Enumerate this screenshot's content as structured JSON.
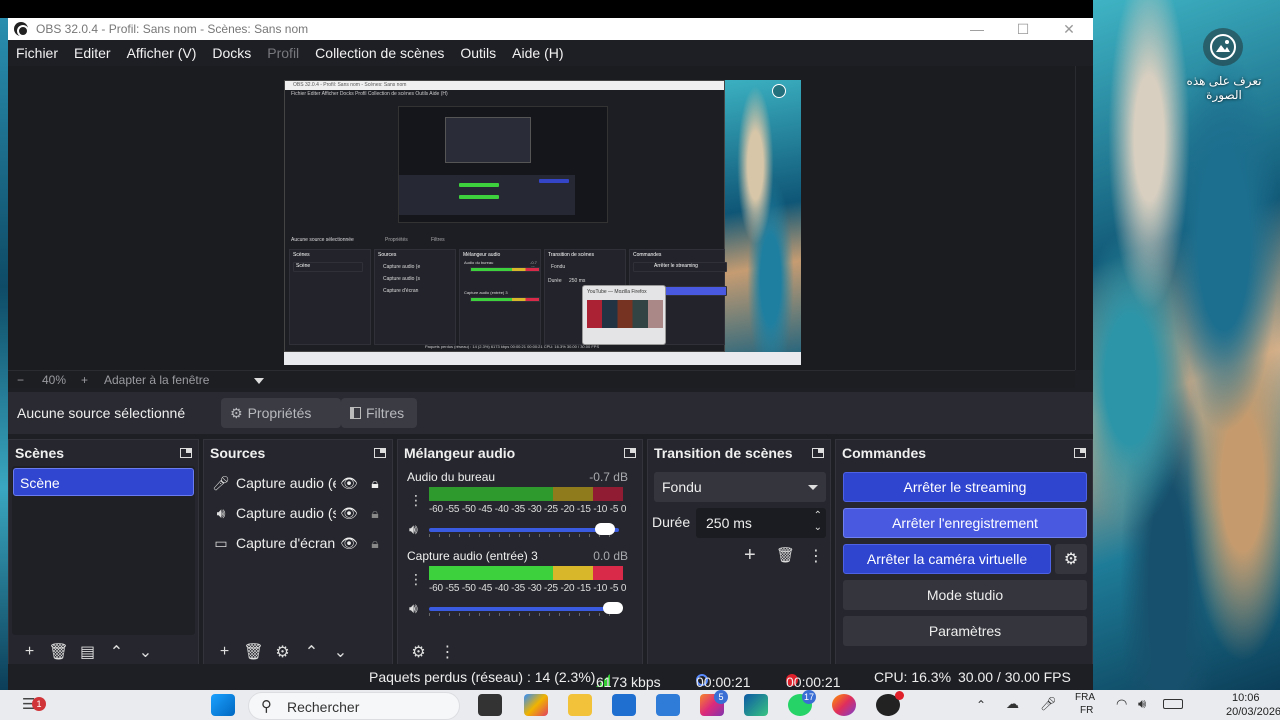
{
  "window": {
    "title": "OBS 32.0.4 - Profil: Sans nom - Scènes: Sans nom",
    "minimize": "—",
    "maximize": "☐",
    "close": "✕"
  },
  "menu": [
    "Fichier",
    "Editer",
    "Afficher (V)",
    "Docks",
    "Profil",
    "Collection de scènes",
    "Outils",
    "Aide (H)"
  ],
  "zoom": {
    "minus": "−",
    "level": "40%",
    "plus": "+",
    "fit": "Adapter à la fenêtre"
  },
  "source_toolbar": {
    "no_source": "Aucune source sélectionné",
    "properties": "Propriétés",
    "filters": "Filtres"
  },
  "scenes": {
    "title": "Scènes",
    "items": [
      "Scène"
    ]
  },
  "sources": {
    "title": "Sources",
    "items": [
      {
        "name": "Capture audio (entrée)",
        "icon": "microphone-icon"
      },
      {
        "name": "Capture audio (sortie)",
        "icon": "speaker-icon"
      },
      {
        "name": "Capture d'écran",
        "icon": "monitor-icon"
      }
    ]
  },
  "mixer": {
    "title": "Mélangeur audio",
    "ticks": "-60 -55 -50 -45 -40 -35 -30 -25 -20 -15 -10  -5   0",
    "channels": [
      {
        "name": "Audio du bureau",
        "db": "-0.7 dB"
      },
      {
        "name": "Capture audio (entrée) 3",
        "db": "0.0 dB"
      }
    ]
  },
  "transition": {
    "title": "Transition de scènes",
    "type": "Fondu",
    "duration_label": "Durée",
    "duration_value": "250 ms"
  },
  "commands": {
    "title": "Commandes",
    "stop_streaming": "Arrêter le streaming",
    "stop_recording": "Arrêter l'enregistrement",
    "stop_virtualcam": "Arrêter la caméra virtuelle",
    "studio_mode": "Mode studio",
    "settings": "Paramètres"
  },
  "status": {
    "dropped": "Paquets perdus (réseau) : 14 (2.3%)",
    "bitrate": "6173 kbps",
    "stream_time": "00:00:21",
    "rec_time": "00:00:21",
    "cpu": "CPU: 16.3%",
    "fps": "30.00 / 30.00 FPS"
  },
  "preview_mini": {
    "title": "OBS 32.0.4 - Profil: Sans nom - Scènes: Sans nom",
    "menu": "Fichier  Editer  Afficher  Docks  Profil  Collection de scènes  Outils  Aide (H)",
    "no_source": "Aucune source sélectionnée",
    "properties": "Propriétés",
    "filters": "Filtres",
    "scenes": "Scènes",
    "scene": "Scène",
    "sources": "Sources",
    "src1": "Capture audio (e",
    "src2": "Capture audio (s",
    "src3": "Capture d'écran",
    "mixer": "Mélangeur audio",
    "mix1": "Audio du bureau",
    "mix1_db": "-0.7 dB",
    "mix2": "Capture audio (entrée) 3",
    "transition": "Transition de scènes",
    "fade": "Fondu",
    "dur": "Durée",
    "dur_val": "250 ms",
    "commands": "Commandes",
    "stream_btn": "Arrêter le streaming",
    "popup": "YouTube — Mozilla Firefox",
    "status": "Paquets perdus (réseau) : 14 (2.3%)   6173 kbps   00:00:21   00:00:21   CPU: 16.3%   30.00 / 30.00 FPS"
  },
  "desktop": {
    "icon_label": "تعرف على هذه الصورة"
  },
  "taskbar": {
    "search": "Rechercher",
    "notif_count": "1",
    "badge_a": "5",
    "badge_b": "17",
    "lang_top": "FRA",
    "lang_bottom": "FR",
    "time": "10:06",
    "date": "20/03/2026"
  },
  "colors": {
    "accent": "#2f45cf",
    "record": "#e0202a",
    "meter_green": "#3dd13d",
    "meter_yellow": "#d9b72a",
    "meter_red": "#d92a4a"
  }
}
